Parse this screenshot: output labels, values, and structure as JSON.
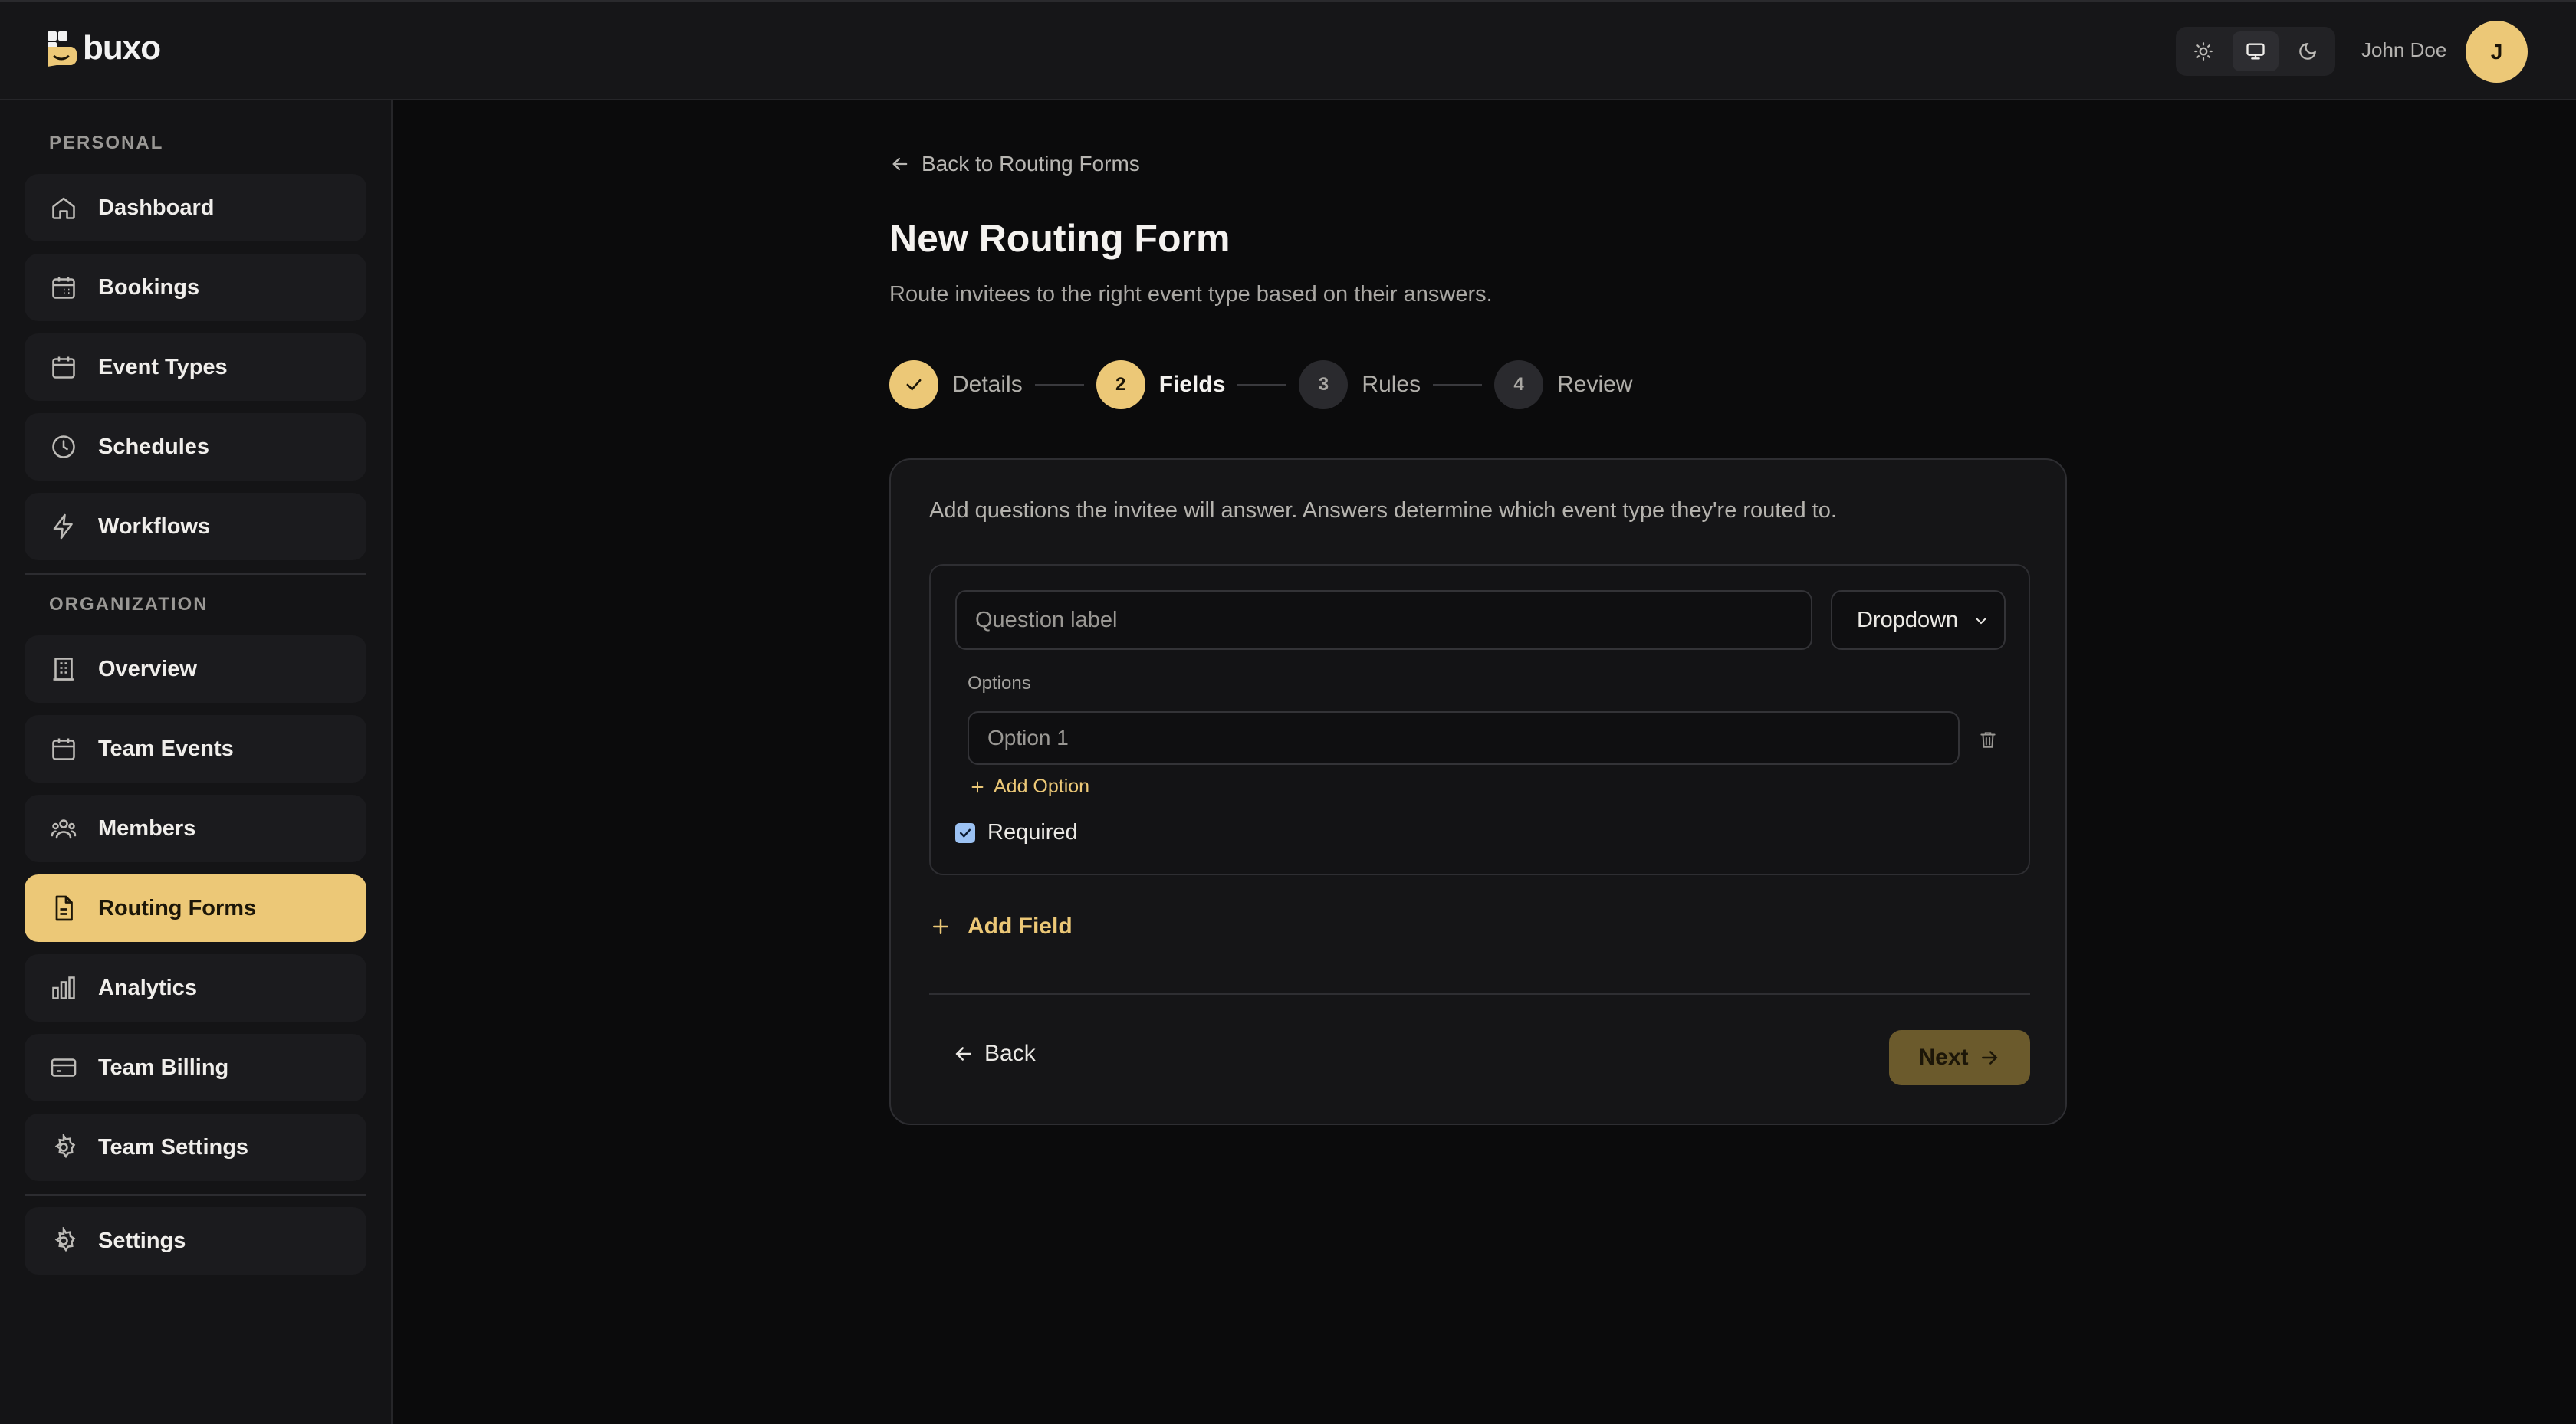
{
  "header": {
    "brand": "buxo",
    "user_name": "John Doe",
    "avatar_initial": "J",
    "theme_modes": [
      "light",
      "system",
      "dark"
    ],
    "active_theme": "system"
  },
  "sidebar": {
    "personal_label": "PERSONAL",
    "organization_label": "ORGANIZATION",
    "personal_items": [
      {
        "label": "Dashboard",
        "icon": "home-icon"
      },
      {
        "label": "Bookings",
        "icon": "calendar-icon"
      },
      {
        "label": "Event Types",
        "icon": "calendar-icon"
      },
      {
        "label": "Schedules",
        "icon": "clock-icon"
      },
      {
        "label": "Workflows",
        "icon": "lightning-icon"
      }
    ],
    "org_items": [
      {
        "label": "Overview",
        "icon": "building-icon"
      },
      {
        "label": "Team Events",
        "icon": "calendar-icon"
      },
      {
        "label": "Members",
        "icon": "users-icon"
      },
      {
        "label": "Routing Forms",
        "icon": "document-icon",
        "active": true
      },
      {
        "label": "Analytics",
        "icon": "bar-chart-icon"
      },
      {
        "label": "Team Billing",
        "icon": "credit-card-icon"
      },
      {
        "label": "Team Settings",
        "icon": "gear-icon"
      }
    ],
    "settings_item": {
      "label": "Settings",
      "icon": "gear-icon"
    }
  },
  "main": {
    "back_link": "Back to Routing Forms",
    "title": "New Routing Form",
    "subtitle": "Route invitees to the right event type based on their answers.",
    "steps": [
      {
        "number": "1",
        "label": "Details",
        "state": "done"
      },
      {
        "number": "2",
        "label": "Fields",
        "state": "current"
      },
      {
        "number": "3",
        "label": "Rules",
        "state": "todo"
      },
      {
        "number": "4",
        "label": "Review",
        "state": "todo"
      }
    ],
    "intro": "Add questions the invitee will answer. Answers determine which event type they're routed to.",
    "field": {
      "question_placeholder": "Question label",
      "question_value": "",
      "type_selected": "Dropdown",
      "options_label": "Options",
      "option_placeholder": "Option 1",
      "add_option": "Add Option",
      "required_label": "Required",
      "required_checked": true
    },
    "add_field": "Add Field",
    "back_button": "Back",
    "next_button": "Next"
  },
  "colors": {
    "accent": "#ecc877",
    "background": "#0b0b0c",
    "panel": "#151517"
  }
}
